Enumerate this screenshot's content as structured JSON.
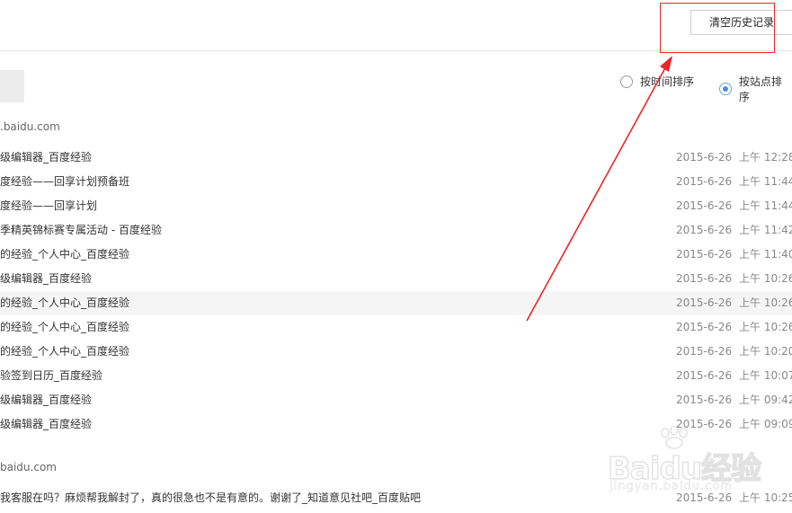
{
  "toolbar": {
    "clear_history_label": "清空历史记录"
  },
  "sort": {
    "by_time_label": "按时间排序",
    "by_site_label": "按站点排序",
    "selected": "by_site"
  },
  "groups": [
    {
      "site": ".baidu.com",
      "items": [
        {
          "title": "级编辑器_百度经验",
          "date": "2015-6-26",
          "time": "上午 12:28"
        },
        {
          "title": "度经验——回享计划预备班",
          "date": "2015-6-26",
          "time": "上午 11:44"
        },
        {
          "title": "度经验——回享计划",
          "date": "2015-6-26",
          "time": "上午 11:44"
        },
        {
          "title": "季精英锦标赛专属活动 - 百度经验",
          "date": "2015-6-26",
          "time": "上午 11:42"
        },
        {
          "title": "的经验_个人中心_百度经验",
          "date": "2015-6-26",
          "time": "上午 11:40"
        },
        {
          "title": "级编辑器_百度经验",
          "date": "2015-6-26",
          "time": "上午 10:26"
        },
        {
          "title": "的经验_个人中心_百度经验",
          "date": "2015-6-26",
          "time": "上午 10:26"
        },
        {
          "title": "的经验_个人中心_百度经验",
          "date": "2015-6-26",
          "time": "上午 10:26"
        },
        {
          "title": "的经验_个人中心_百度经验",
          "date": "2015-6-26",
          "time": "上午 10:20"
        },
        {
          "title": "验签到日历_百度经验",
          "date": "2015-6-26",
          "time": "上午 10:07"
        },
        {
          "title": "级编辑器_百度经验",
          "date": "2015-6-26",
          "time": "上午 09:42"
        },
        {
          "title": "级编辑器_百度经验",
          "date": "2015-6-26",
          "time": "上午 09:09"
        }
      ]
    },
    {
      "site": "baidu.com",
      "items": [
        {
          "title": "我客服在吗？麻烦帮我解封了，真的很急也不是有意的。谢谢了_知道意见社吧_百度贴吧",
          "date": "2015-6-26",
          "time": "上午 10:25"
        }
      ]
    }
  ],
  "watermark": {
    "text": "Baidu经验",
    "sub": "jingyan.baidu.com"
  },
  "annotation": {
    "color": "#e8262b"
  }
}
